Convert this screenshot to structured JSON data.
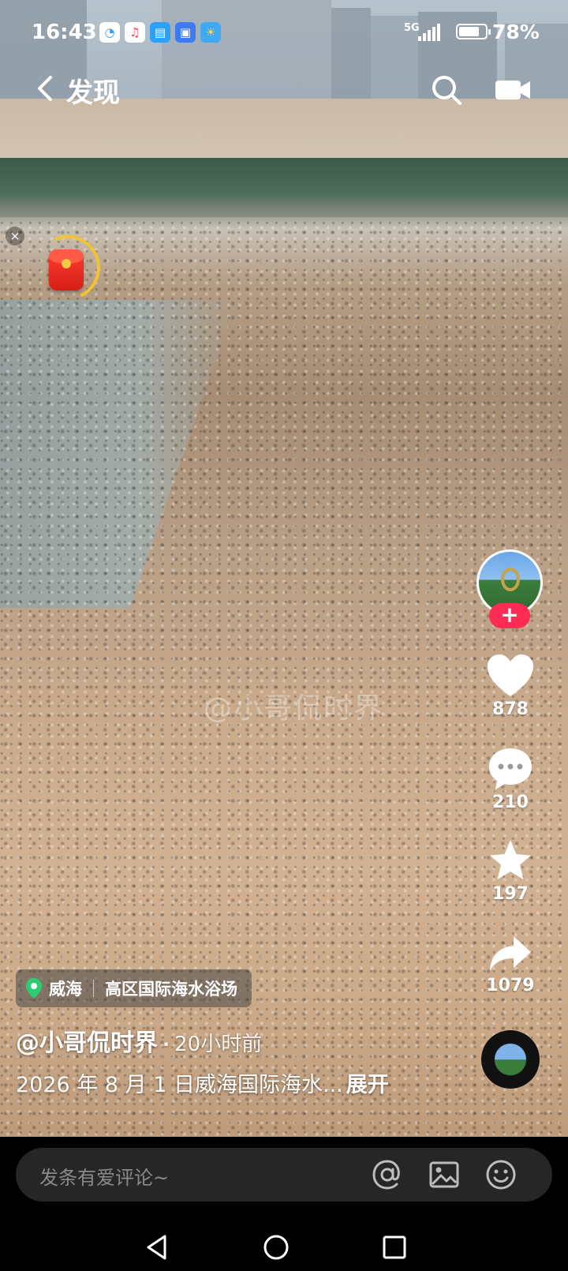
{
  "status_bar": {
    "time": "16:43",
    "network": "5G",
    "battery_percent": "78%",
    "battery_level": 0.78
  },
  "nav": {
    "back_icon": "chevron-left-icon",
    "title": "发现",
    "search_icon": "search-icon",
    "camera_icon": "video-camera-icon"
  },
  "video": {
    "watermark": "@小哥侃时界"
  },
  "red_packet": {
    "close_label": "×"
  },
  "right_rail": {
    "follow_label": "+",
    "likes": "878",
    "comments": "210",
    "favorites": "197",
    "shares": "1079"
  },
  "location": {
    "city": "威海",
    "place": "高区国际海水浴场"
  },
  "post": {
    "author": "@小哥侃时界",
    "separator": "·",
    "time_ago": "20小时前",
    "description": "2026 年 8 月 1 日威海国际海水...",
    "expand_label": "展开"
  },
  "comment_bar": {
    "placeholder": "发条有爱评论~"
  },
  "colors": {
    "accent": "#fe2c55",
    "location_pin": "#2ecc71",
    "packet_red": "#e5261c",
    "background": "#000000"
  }
}
